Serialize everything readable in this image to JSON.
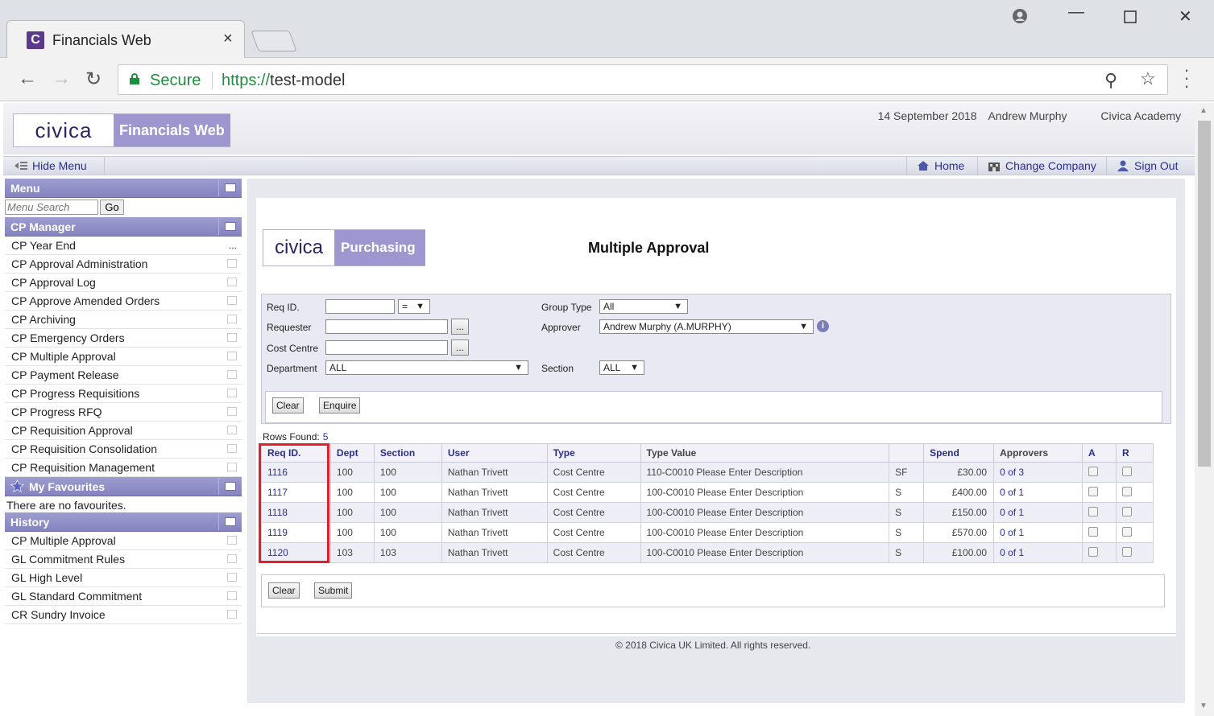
{
  "browser": {
    "tab_title": "Financials Web",
    "tab_close": "×",
    "favicon_letter": "C",
    "secure_label": "Secure",
    "url_scheme": "https://",
    "url_host": "test-model"
  },
  "header": {
    "logo_civica": "civica",
    "logo_product": "Financials Web",
    "date": "14 September 2018",
    "user": "Andrew Murphy",
    "company": "Civica Academy"
  },
  "subbar": {
    "hide_menu": "Hide Menu",
    "home": "Home",
    "change_company": "Change Company",
    "sign_out": "Sign Out"
  },
  "sidebar": {
    "menu_title": "Menu",
    "search_placeholder": "Menu Search",
    "go_label": "Go",
    "cp_manager_title": "CP Manager",
    "cp_items": [
      "CP Year End",
      "CP Approval Administration",
      "CP Approval Log",
      "CP Approve Amended Orders",
      "CP Archiving",
      "CP Emergency Orders",
      "CP Multiple Approval",
      "CP Payment Release",
      "CP Progress Requisitions",
      "CP Progress RFQ",
      "CP Requisition Approval",
      "CP Requisition Consolidation",
      "CP Requisition Management"
    ],
    "favourites_title": "My Favourites",
    "favourites_empty": "There are no favourites.",
    "history_title": "History",
    "history_items": [
      "CP Multiple Approval",
      "GL Commitment Rules",
      "GL High Level",
      "GL Standard Commitment",
      "CR Sundry Invoice"
    ]
  },
  "main": {
    "logo_civica": "civica",
    "logo_product": "Purchasing",
    "title": "Multiple Approval",
    "filters": {
      "req_id_label": "Req ID.",
      "req_id_op": "=",
      "requester_label": "Requester",
      "cost_centre_label": "Cost Centre",
      "department_label": "Department",
      "department_value": "ALL",
      "group_type_label": "Group Type",
      "group_type_value": "All",
      "approver_label": "Approver",
      "approver_value": "Andrew Murphy (A.MURPHY)",
      "section_label": "Section",
      "section_value": "ALL",
      "lookup_btn": "...",
      "clear_btn": "Clear",
      "enquire_btn": "Enquire"
    },
    "rows_found_label": "Rows Found:",
    "rows_found_count": "5",
    "table": {
      "headers": [
        "Req ID.",
        "Dept",
        "Section",
        "User",
        "Type",
        "Type Value",
        "",
        "Spend",
        "Approvers",
        "A",
        "R"
      ],
      "rows": [
        {
          "req": "1116",
          "dept": "100",
          "section": "100",
          "user": "Nathan Trivett",
          "type": "Cost Centre",
          "type_value": "110-C0010 Please Enter Description",
          "flag": "SF",
          "spend": "£30.00",
          "approvers": "0 of 3"
        },
        {
          "req": "1117",
          "dept": "100",
          "section": "100",
          "user": "Nathan Trivett",
          "type": "Cost Centre",
          "type_value": "100-C0010 Please Enter Description",
          "flag": "S",
          "spend": "£400.00",
          "approvers": "0 of 1"
        },
        {
          "req": "1118",
          "dept": "100",
          "section": "100",
          "user": "Nathan Trivett",
          "type": "Cost Centre",
          "type_value": "100-C0010 Please Enter Description",
          "flag": "S",
          "spend": "£150.00",
          "approvers": "0 of 1"
        },
        {
          "req": "1119",
          "dept": "100",
          "section": "100",
          "user": "Nathan Trivett",
          "type": "Cost Centre",
          "type_value": "100-C0010 Please Enter Description",
          "flag": "S",
          "spend": "£570.00",
          "approvers": "0 of 1"
        },
        {
          "req": "1120",
          "dept": "103",
          "section": "103",
          "user": "Nathan Trivett",
          "type": "Cost Centre",
          "type_value": "100-C0010 Please Enter Description",
          "flag": "S",
          "spend": "£100.00",
          "approvers": "0 of 1"
        }
      ]
    },
    "bottom": {
      "clear_btn": "Clear",
      "submit_btn": "Submit"
    }
  },
  "footer": {
    "copyright": "© 2018 Civica UK Limited. All rights reserved."
  },
  "colors": {
    "brand_purple": "#9e97cf",
    "link": "#2b2f8c",
    "highlight_red": "#e0202a"
  }
}
